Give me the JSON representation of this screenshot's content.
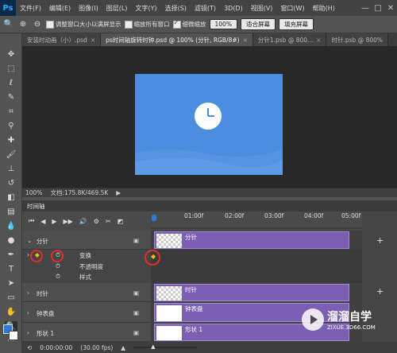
{
  "app": {
    "logo": "Ps"
  },
  "menu": [
    "文件(F)",
    "编辑(E)",
    "图像(I)",
    "图层(L)",
    "文字(Y)",
    "选择(S)",
    "滤镜(T)",
    "3D(D)",
    "视图(V)",
    "窗口(W)",
    "帮助(H)"
  ],
  "window_controls": [
    "—",
    "□",
    "✕"
  ],
  "options": {
    "resize_windows_label": "调整窗口大小以满屏显示",
    "resize_windows_checked": false,
    "zoom_all_label": "缩放所有窗口",
    "zoom_all_checked": false,
    "scrubby_zoom_label": "细微缩放",
    "scrubby_zoom_checked": true,
    "zoom_value": "100%",
    "fit_screen_label": "适合屏幕",
    "fill_screen_label": "填充屏幕"
  },
  "tabs": [
    {
      "label": "安装时动画（小）.psd",
      "active": false
    },
    {
      "label": "ps时间轴旋转时钟.psd @ 100% (分针, RGB/8#)",
      "active": true
    },
    {
      "label": "分针1.psb @ 800...",
      "active": false
    },
    {
      "label": "时针.psb @ 800%",
      "active": false
    }
  ],
  "status": {
    "zoom": "100%",
    "doc": "文档:175.8K/469.5K"
  },
  "timeline": {
    "panel_title": "时间轴",
    "ruler_labels": [
      "01:00f",
      "02:00f",
      "03:00f",
      "04:00f",
      "05:00f"
    ],
    "layers": [
      {
        "name": "分针",
        "clip": "分针",
        "expanded": true
      },
      {
        "name": "时针",
        "clip": "时针"
      },
      {
        "name": "钟表盘",
        "clip": "钟表盘"
      },
      {
        "name": "形状 1",
        "clip": "形状 1"
      }
    ],
    "sub_props": [
      "变换",
      "不透明度",
      "样式"
    ],
    "footer_time": "0:00:00:00",
    "footer_fps": "(30.00 fps)"
  },
  "watermark": {
    "title": "溜溜自学",
    "url": "ZIXUE.3D66.COM"
  },
  "colors": {
    "accent": "#4d8de0",
    "clip": "#7b5fb3",
    "highlight": "#e0302a"
  }
}
